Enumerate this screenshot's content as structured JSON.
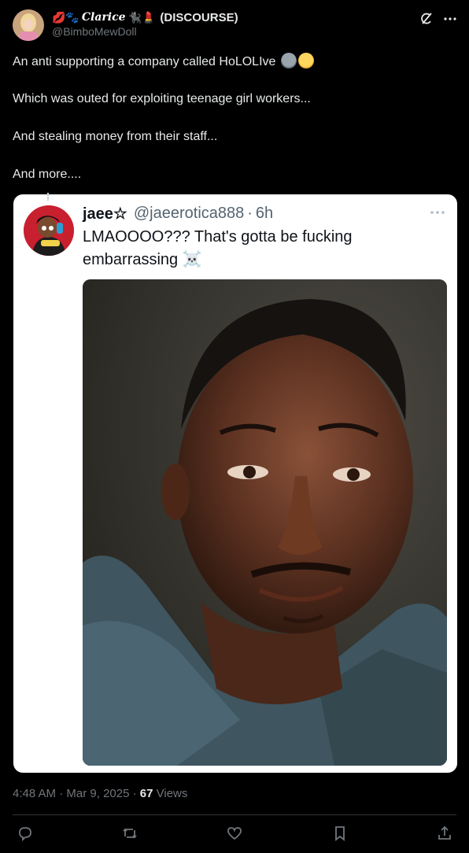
{
  "author": {
    "display_name_decor_left": "💋🐾",
    "display_name_styled": "Clarice",
    "display_name_decor_right": "🐈‍⬛💄",
    "display_name_suffix": "(DISCOURSE)",
    "handle": "@BimboMewDoll"
  },
  "tweet": {
    "lines": [
      "An anti supporting a company called HoLOLIve",
      "Which was outed for exploiting teenage girl workers...",
      "And stealing money from their staff...",
      "And more...."
    ]
  },
  "quoted": {
    "name": "jaee☆",
    "handle": "@jaeerotica888",
    "separator": "·",
    "time": "6h",
    "text_line1": "LMAOOOO??? That's gotta be fucking",
    "text_line2": "embarrassing",
    "text_emoji": "☠️"
  },
  "footer": {
    "time": "4:48 AM",
    "dot1": "·",
    "date": "Mar 9, 2025",
    "dot2": "·",
    "views_count": "67",
    "views_label": "Views"
  },
  "icons": [
    "grok-icon",
    "more-icon",
    "reply-icon",
    "retweet-icon",
    "like-icon",
    "bookmark-icon",
    "share-icon"
  ],
  "colors": {
    "background": "#000000",
    "text": "#e7e9ea",
    "muted": "#71767b",
    "card": "#ffffff"
  }
}
